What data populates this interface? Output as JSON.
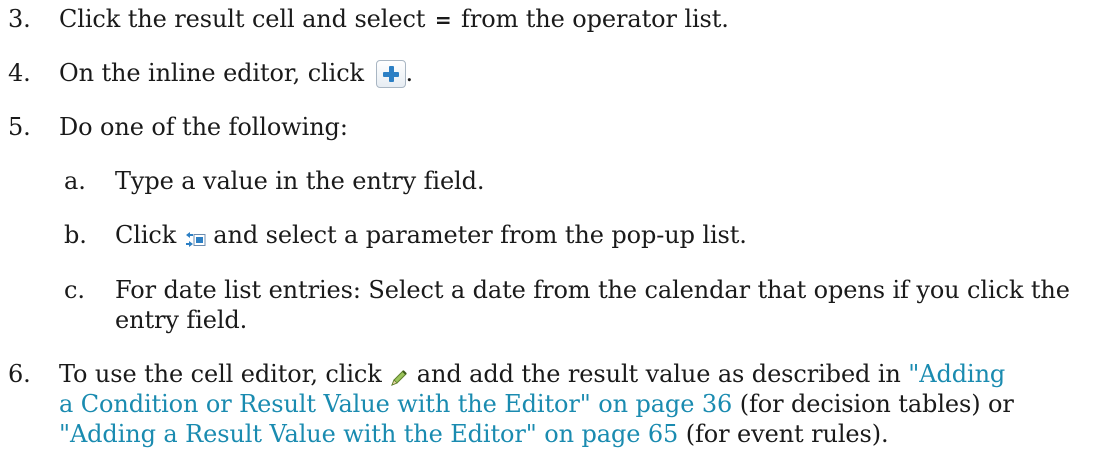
{
  "step3": {
    "num": "3.",
    "text_before": "Click the result cell and select ",
    "operator": "=",
    "text_after": " from the operator list."
  },
  "step4": {
    "num": "4.",
    "text_before": "On the inline editor, click ",
    "icon": "add-plus-icon",
    "text_after": "."
  },
  "step5": {
    "num": "5.",
    "text": "Do one of the following:",
    "sub": [
      {
        "num": "a.",
        "text": "Type a value in the entry field."
      },
      {
        "num": "b.",
        "text_before": "Click ",
        "icon": "parameter-list-icon",
        "text_after": " and select a parameter from the pop-up list."
      },
      {
        "num": "c.",
        "line1": "For date list entries: Select a date from the calendar that opens if you click the",
        "line2": "entry field."
      }
    ]
  },
  "step6": {
    "num": "6.",
    "l1_before": "To use the cell editor, click ",
    "icon": "pencil-edit-icon",
    "l1_after": " and add the result value as described in ",
    "link1_part1": "\"Adding",
    "link1_part2": "a Condition or Result Value with the Editor\" on page 36",
    "l2_mid": " (for decision tables) or",
    "link2": "\"Adding a Result Value with the Editor\" on page 65",
    "l3_after": " (for event rules)."
  },
  "colors": {
    "text": "#1a1a1a",
    "link": "#1a8bb0",
    "icon_blue": "#2c7fc4"
  }
}
